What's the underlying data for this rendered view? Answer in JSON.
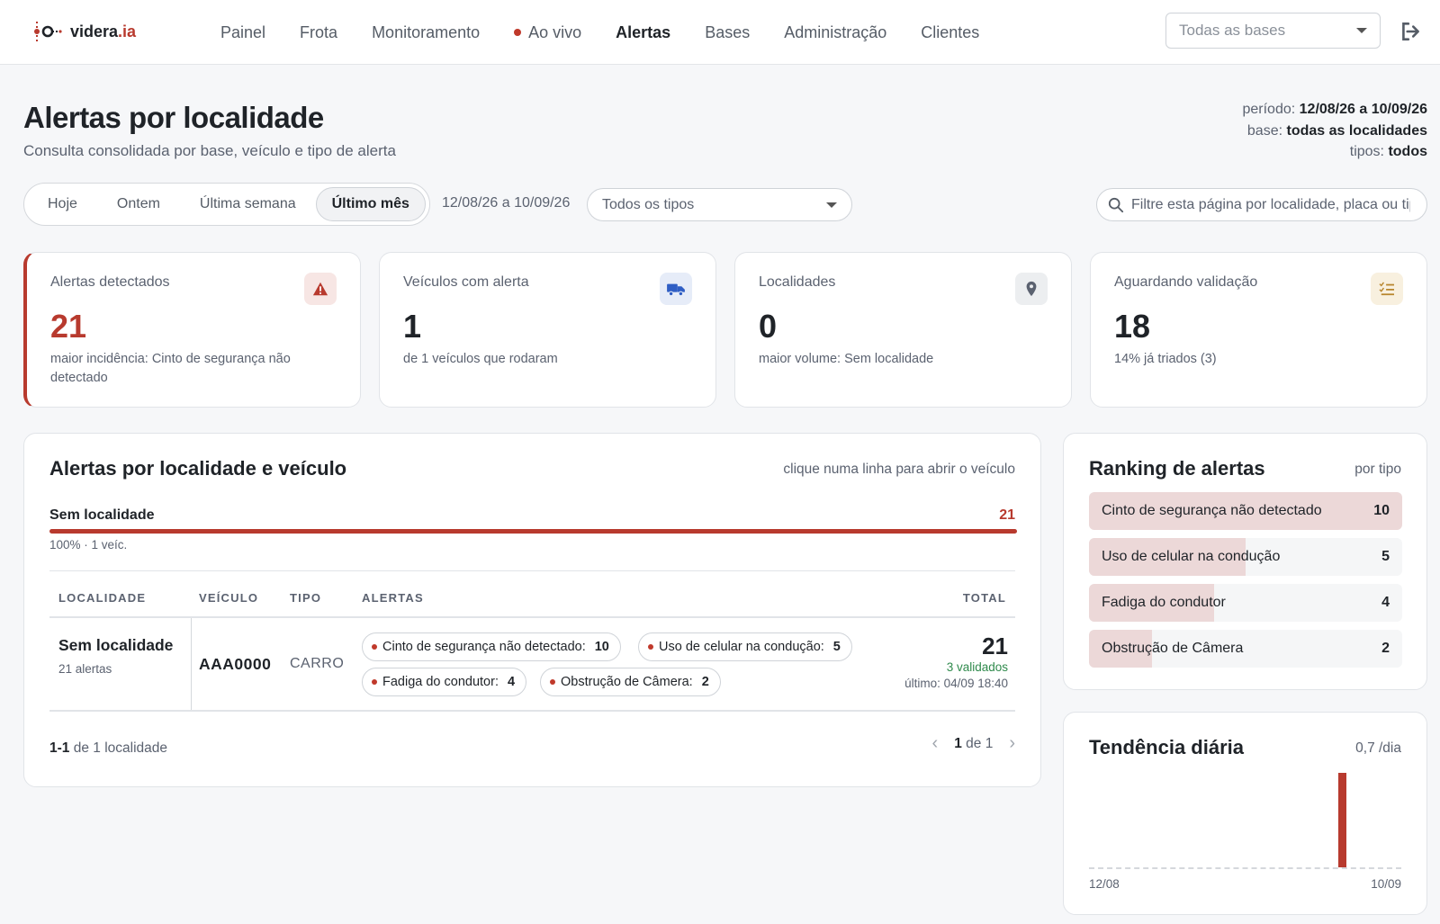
{
  "brand": {
    "name": "videra",
    "suffix": ".ia"
  },
  "nav": [
    {
      "label": "Painel"
    },
    {
      "label": "Frota"
    },
    {
      "label": "Monitoramento"
    },
    {
      "label": "Ao vivo"
    },
    {
      "label": "Alertas"
    },
    {
      "label": "Bases"
    },
    {
      "label": "Administração"
    },
    {
      "label": "Clientes"
    }
  ],
  "base_select": {
    "value": "Todas as bases"
  },
  "page": {
    "title": "Alertas por localidade",
    "subtitle": "Consulta consolidada por base, veículo e tipo de alerta"
  },
  "meta": {
    "period_label": "período:",
    "period_value": "12/08/26 a 10/09/26",
    "base_label": "base:",
    "base_value": "todas as localidades",
    "types_label": "tipos:",
    "types_value": "todos"
  },
  "filters": {
    "ranges": [
      "Hoje",
      "Ontem",
      "Última semana",
      "Último mês"
    ],
    "active_range": "Último mês",
    "date_range": "12/08/26 a 10/09/26",
    "type_select": "Todos os tipos",
    "search_placeholder": "Filtre esta página por localidade, placa ou tipo"
  },
  "cards": [
    {
      "label": "Alertas detectados",
      "value": "21",
      "sub": "maior incidência: Cinto de segurança não detectado",
      "icon": "warning-icon",
      "accent": "#b83a2e"
    },
    {
      "label": "Veículos com alerta",
      "value": "1",
      "sub": "de 1 veículos que rodaram",
      "icon": "truck-icon",
      "accent": "#2f5ec4"
    },
    {
      "label": "Localidades",
      "value": "0",
      "sub": "maior volume: Sem localidade",
      "icon": "map-pin-icon",
      "accent": "#5b6270"
    },
    {
      "label": "Aguardando validação",
      "value": "18",
      "sub": "14% já triados (3)",
      "icon": "checklist-icon",
      "accent": "#b8862e"
    }
  ],
  "location_panel": {
    "title": "Alertas por localidade e veículo",
    "hint": "clique numa linha para abrir o veículo",
    "summary": {
      "name": "Sem localidade",
      "count": "21",
      "share": "100% · 1 veíc.",
      "fraction": 1.0
    },
    "columns": [
      "LOCALIDADE",
      "VEÍCULO",
      "TIPO",
      "ALERTAS",
      "TOTAL"
    ],
    "rows": [
      {
        "location": "Sem localidade",
        "location_sub": "21 alertas",
        "plate": "AAA0000",
        "type": "CARRO",
        "alerts": [
          {
            "label": "Cinto de segurança não detectado:",
            "count": "10"
          },
          {
            "label": "Uso de celular na condução:",
            "count": "5"
          },
          {
            "label": "Fadiga do condutor:",
            "count": "4"
          },
          {
            "label": "Obstrução de Câmera:",
            "count": "2"
          }
        ],
        "total": "21",
        "validated": "3 validados",
        "last": "último: 04/09 18:40"
      }
    ],
    "footer": {
      "range": "1-1",
      "of_text": "de 1 localidade",
      "page": "1",
      "page_of": "de 1"
    }
  },
  "ranking": {
    "title": "Ranking de alertas",
    "hint": "por tipo",
    "max": 10,
    "items": [
      {
        "label": "Cinto de segurança não detectado",
        "value": 10
      },
      {
        "label": "Uso de celular na condução",
        "value": 5
      },
      {
        "label": "Fadiga do condutor",
        "value": 4
      },
      {
        "label": "Obstrução de Câmera",
        "value": 2
      }
    ]
  },
  "trend": {
    "title": "Tendência diária",
    "hint": "0,7 /dia",
    "x_start": "12/08",
    "x_end": "10/09",
    "chart_data": {
      "type": "bar",
      "start_label": "12/08",
      "end_label": "10/09",
      "values": [
        0,
        0,
        0,
        0,
        0,
        0,
        0,
        0,
        0,
        0,
        0,
        0,
        0,
        0,
        0,
        0,
        0,
        0,
        0,
        0,
        0,
        0,
        0,
        0,
        21,
        0,
        0,
        0,
        0,
        0
      ],
      "ylim": [
        0,
        21
      ]
    }
  }
}
